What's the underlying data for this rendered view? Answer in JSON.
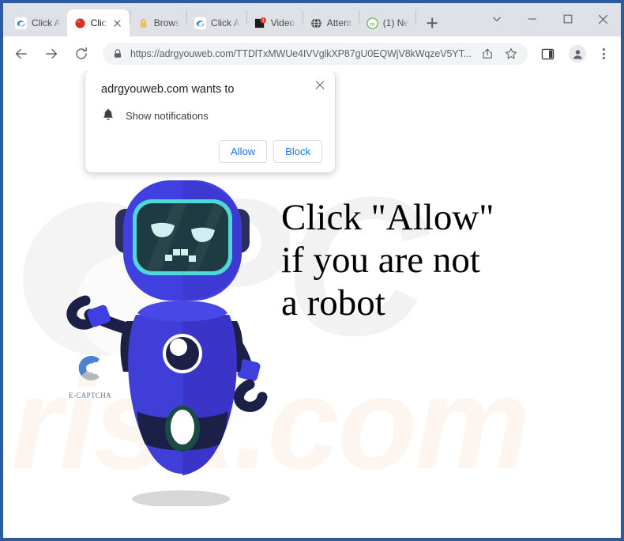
{
  "window": {
    "controls": [
      {
        "name": "tab-search",
        "icon": "chevron-down-icon"
      },
      {
        "name": "minimize",
        "icon": "minimize-icon"
      },
      {
        "name": "maximize",
        "icon": "maximize-icon"
      },
      {
        "name": "close",
        "icon": "close-icon"
      }
    ]
  },
  "tabs": [
    {
      "label": "Click A",
      "favicon": "edge-swirl-icon",
      "active": false,
      "badge": ""
    },
    {
      "label": "Clic",
      "favicon": "red-dot-icon",
      "active": true,
      "badge": ""
    },
    {
      "label": "Brows",
      "favicon": "yellow-lock-icon",
      "active": false,
      "badge": ""
    },
    {
      "label": "Click A",
      "favicon": "edge-swirl-icon",
      "active": false,
      "badge": ""
    },
    {
      "label": "Video",
      "favicon": "video-badge-icon",
      "active": false,
      "badge": "1"
    },
    {
      "label": "Attent",
      "favicon": "globe-icon",
      "active": false,
      "badge": ""
    },
    {
      "label": "(1) Ne",
      "favicon": "green-m-icon",
      "active": false,
      "badge": ""
    }
  ],
  "newtab_label": "+",
  "toolbar": {
    "back": "Back",
    "forward": "Forward",
    "reload": "Reload",
    "url": "https://adrgyouweb.com/TTDlTxMWUe4IVVglkXP87gU0EQWjV8kWqzeV5YT...",
    "url_domain": "adrgyouweb.com",
    "lock_icon": "lock-icon",
    "share_icon": "share-icon",
    "bookmark_icon": "star-icon",
    "sidepanel_icon": "side-panel-icon",
    "profile_icon": "profile-avatar-icon",
    "menu_icon": "kebab-menu-icon"
  },
  "dialog": {
    "title": "adrgyouweb.com wants to",
    "permission": "Show notifications",
    "permission_icon": "bell-icon",
    "allow_label": "Allow",
    "block_label": "Block",
    "close_icon": "close-icon"
  },
  "page": {
    "headline_lines": [
      "Click \"Allow\"",
      "if you are not",
      "a robot"
    ],
    "captcha_label": "E-CAPTCHA",
    "watermark_top": "PC",
    "watermark_bottom": "risk.com",
    "colors": {
      "robot_body": "#3f3fd8",
      "robot_body_dark": "#3a34c9",
      "robot_visor": "#1e3a42",
      "robot_visor_border": "#4fd8d8",
      "robot_dark": "#1c2047",
      "accent_blue": "#1a73e8"
    }
  }
}
